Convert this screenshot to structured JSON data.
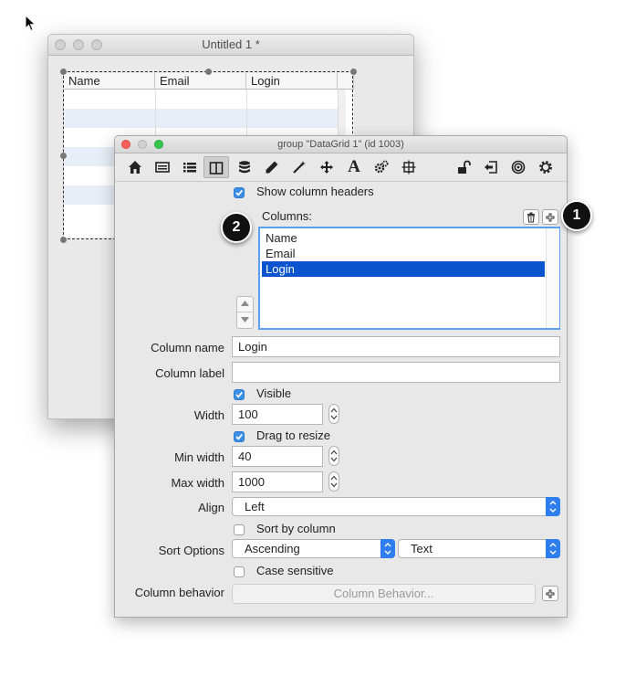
{
  "back_window": {
    "title": "Untitled 1 *",
    "grid_headers": [
      "Name",
      "Email",
      "Login"
    ]
  },
  "inspector": {
    "title": "group \"DataGrid 1\" (id 1003)",
    "toolbar_icons": [
      "home-icon",
      "card-icon",
      "list-icon",
      "columns-icon",
      "database-icon",
      "pencil-icon",
      "magic-wand-icon",
      "move-icon",
      "text-icon",
      "gears-icon",
      "resize-icon",
      "unlock-icon",
      "export-icon",
      "target-icon",
      "gear-icon"
    ],
    "show_column_headers": {
      "label": "Show column headers",
      "checked": true
    },
    "columns": {
      "label": "Columns:",
      "items": [
        "Name",
        "Email",
        "Login"
      ],
      "selected": "Login"
    },
    "column_name": {
      "label": "Column name",
      "value": "Login"
    },
    "column_label": {
      "label": "Column label",
      "value": ""
    },
    "visible": {
      "label": "Visible",
      "checked": true
    },
    "width": {
      "label": "Width",
      "value": "100"
    },
    "drag_to_resize": {
      "label": "Drag to resize",
      "checked": true
    },
    "min_width": {
      "label": "Min width",
      "value": "40"
    },
    "max_width": {
      "label": "Max width",
      "value": "1000"
    },
    "align": {
      "label": "Align",
      "value": "Left"
    },
    "sort_by_column": {
      "label": "Sort by column",
      "checked": false
    },
    "sort_options": {
      "label": "Sort Options",
      "order": "Ascending",
      "type": "Text"
    },
    "case_sensitive": {
      "label": "Case sensitive",
      "checked": false
    },
    "column_behavior": {
      "label": "Column behavior",
      "button": "Column Behavior..."
    }
  },
  "callouts": [
    "1",
    "2"
  ],
  "colors": {
    "accent": "#2f7ef0",
    "selection": "#0a55cf",
    "close": "#fc605c",
    "minimize": "#fdbc40",
    "zoom": "#34c84a"
  }
}
